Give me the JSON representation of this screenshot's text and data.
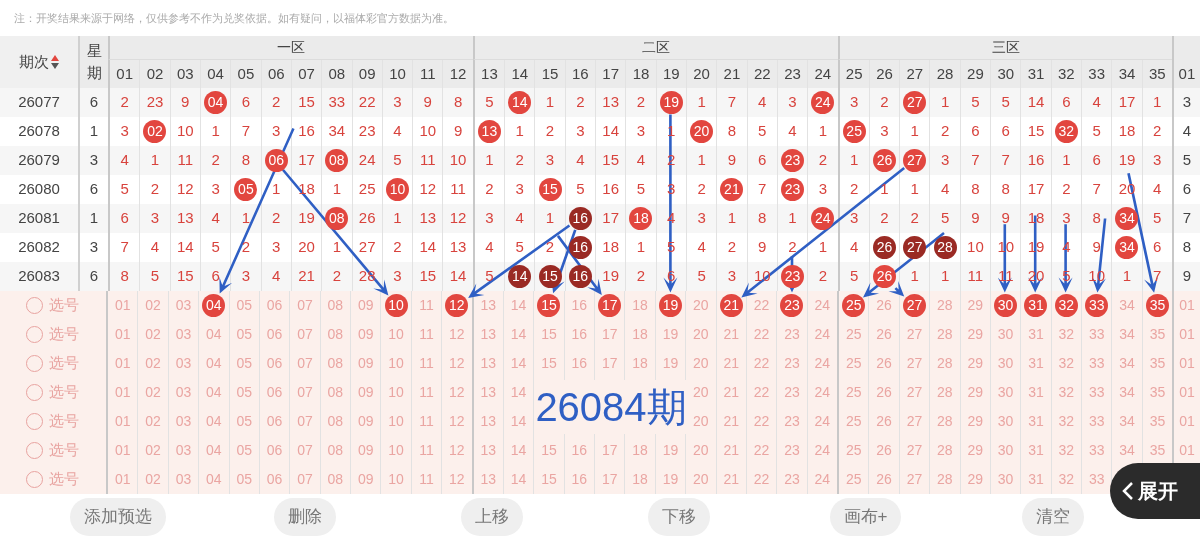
{
  "note": "注：开奖结果来源于网络，仅供参考不作为兑奖依据。如有疑问，以福体彩官方数据为准。",
  "header": {
    "issue": "期次",
    "weekday": "星期",
    "zones": [
      "一区",
      "二区",
      "三区"
    ],
    "columns": [
      "01",
      "02",
      "03",
      "04",
      "05",
      "06",
      "07",
      "08",
      "09",
      "10",
      "11",
      "12",
      "13",
      "14",
      "15",
      "16",
      "17",
      "18",
      "19",
      "20",
      "21",
      "22",
      "23",
      "24",
      "25",
      "26",
      "27",
      "28",
      "29",
      "30",
      "31",
      "32",
      "33",
      "34",
      "35",
      "01"
    ]
  },
  "rows": [
    {
      "issue": "26077",
      "weekday": "6",
      "cells": [
        "2",
        "23",
        "9",
        {
          "text": "04",
          "color": "#e2463f"
        },
        "6",
        "2",
        "15",
        "33",
        "22",
        "3",
        "9",
        "8",
        "5",
        {
          "text": "14",
          "color": "#e2463f"
        },
        "1",
        "2",
        "13",
        "2",
        {
          "text": "19",
          "color": "#e2463f"
        },
        "1",
        "7",
        "4",
        "3",
        {
          "text": "24",
          "color": "#e2463f"
        },
        "3",
        "2",
        {
          "text": "27",
          "color": "#e2463f"
        },
        "1",
        "5",
        "5",
        "14",
        "6",
        "4",
        "17",
        "1",
        "3"
      ]
    },
    {
      "issue": "26078",
      "weekday": "1",
      "cells": [
        "3",
        {
          "text": "02",
          "color": "#e2463f"
        },
        "10",
        "1",
        "7",
        "3",
        "16",
        "34",
        "23",
        "4",
        "10",
        "9",
        {
          "text": "13",
          "color": "#e2463f"
        },
        "1",
        "2",
        "3",
        "14",
        "3",
        "1",
        {
          "text": "20",
          "color": "#e2463f"
        },
        "8",
        "5",
        "4",
        "1",
        {
          "text": "25",
          "color": "#e2463f"
        },
        "3",
        "1",
        "2",
        "6",
        "6",
        "15",
        {
          "text": "32",
          "color": "#e2463f"
        },
        "5",
        "18",
        "2",
        "4"
      ]
    },
    {
      "issue": "26079",
      "weekday": "3",
      "cells": [
        "4",
        "1",
        "11",
        "2",
        "8",
        {
          "text": "06",
          "color": "#e2463f"
        },
        "17",
        {
          "text": "08",
          "color": "#e2463f"
        },
        "24",
        "5",
        "11",
        "10",
        "1",
        "2",
        "3",
        "4",
        "15",
        "4",
        "2",
        "1",
        "9",
        "6",
        {
          "text": "23",
          "color": "#e2463f"
        },
        "2",
        "1",
        {
          "text": "26",
          "color": "#e2463f"
        },
        {
          "text": "27",
          "color": "#e2463f"
        },
        "3",
        "7",
        "7",
        "16",
        "1",
        "6",
        "19",
        "3",
        "5"
      ]
    },
    {
      "issue": "26080",
      "weekday": "6",
      "cells": [
        "5",
        "2",
        "12",
        "3",
        {
          "text": "05",
          "color": "#e2463f"
        },
        "1",
        "18",
        "1",
        "25",
        {
          "text": "10",
          "color": "#e2463f"
        },
        "12",
        "11",
        "2",
        "3",
        {
          "text": "15",
          "color": "#e2463f"
        },
        "5",
        "16",
        "5",
        "3",
        "2",
        {
          "text": "21",
          "color": "#e2463f"
        },
        "7",
        {
          "text": "23",
          "color": "#e2463f"
        },
        "3",
        "2",
        "1",
        "1",
        "4",
        "8",
        "8",
        "17",
        "2",
        "7",
        "20",
        "4",
        "6"
      ]
    },
    {
      "issue": "26081",
      "weekday": "1",
      "cells": [
        "6",
        "3",
        "13",
        "4",
        "1",
        "2",
        "19",
        {
          "text": "08",
          "color": "#e2463f"
        },
        "26",
        "1",
        "13",
        "12",
        "3",
        "4",
        "1",
        {
          "text": "16",
          "color": "#9a2a24"
        },
        "17",
        {
          "text": "18",
          "color": "#e2463f"
        },
        "4",
        "3",
        "1",
        "8",
        "1",
        {
          "text": "24",
          "color": "#e2463f"
        },
        "3",
        "2",
        "2",
        "5",
        "9",
        "9",
        "18",
        "3",
        "8",
        {
          "text": "34",
          "color": "#e2463f"
        },
        "5",
        "7"
      ]
    },
    {
      "issue": "26082",
      "weekday": "3",
      "cells": [
        "7",
        "4",
        "14",
        "5",
        "2",
        "3",
        "20",
        "1",
        "27",
        "2",
        "14",
        "13",
        "4",
        "5",
        "2",
        {
          "text": "16",
          "color": "#9a2a24"
        },
        "18",
        "1",
        "5",
        "4",
        "2",
        "9",
        "2",
        "1",
        "4",
        {
          "text": "26",
          "color": "#9a2a24"
        },
        {
          "text": "27",
          "color": "#9a2a24"
        },
        {
          "text": "28",
          "color": "#9a2a24"
        },
        "10",
        "10",
        "19",
        "4",
        "9",
        {
          "text": "34",
          "color": "#e2463f"
        },
        "6",
        "8"
      ]
    },
    {
      "issue": "26083",
      "weekday": "6",
      "cells": [
        "8",
        "5",
        "15",
        "6",
        "3",
        "4",
        "21",
        "2",
        "28",
        "3",
        "15",
        "14",
        "5",
        {
          "text": "14",
          "color": "#9a2a24"
        },
        {
          "text": "15",
          "color": "#9a2a24"
        },
        {
          "text": "16",
          "color": "#9a2a24"
        },
        "19",
        "2",
        "6",
        "5",
        "3",
        "10",
        {
          "text": "23",
          "color": "#e2463f"
        },
        "2",
        "5",
        {
          "text": "26",
          "color": "#e2463f"
        },
        "1",
        "1",
        "11",
        "11",
        "20",
        "5",
        "10",
        "1",
        "7",
        "9"
      ]
    }
  ],
  "pick_rows": [
    {
      "label": "选号",
      "checked": false,
      "numbers": [
        {
          "text": "01",
          "selected": false
        },
        {
          "text": "02",
          "selected": false
        },
        {
          "text": "03",
          "selected": false
        },
        {
          "text": "04",
          "selected": true
        },
        {
          "text": "05",
          "selected": false
        },
        {
          "text": "06",
          "selected": false
        },
        {
          "text": "07",
          "selected": false
        },
        {
          "text": "08",
          "selected": false
        },
        {
          "text": "09",
          "selected": false
        },
        {
          "text": "10",
          "selected": true
        },
        {
          "text": "11",
          "selected": false
        },
        {
          "text": "12",
          "selected": true
        },
        {
          "text": "13",
          "selected": false
        },
        {
          "text": "14",
          "selected": false
        },
        {
          "text": "15",
          "selected": true
        },
        {
          "text": "16",
          "selected": false
        },
        {
          "text": "17",
          "selected": true
        },
        {
          "text": "18",
          "selected": false
        },
        {
          "text": "19",
          "selected": true
        },
        {
          "text": "20",
          "selected": false
        },
        {
          "text": "21",
          "selected": true
        },
        {
          "text": "22",
          "selected": false
        },
        {
          "text": "23",
          "selected": true
        },
        {
          "text": "24",
          "selected": false
        },
        {
          "text": "25",
          "selected": true
        },
        {
          "text": "26",
          "selected": false
        },
        {
          "text": "27",
          "selected": true
        },
        {
          "text": "28",
          "selected": false
        },
        {
          "text": "29",
          "selected": false
        },
        {
          "text": "30",
          "selected": true
        },
        {
          "text": "31",
          "selected": true
        },
        {
          "text": "32",
          "selected": true
        },
        {
          "text": "33",
          "selected": true
        },
        {
          "text": "34",
          "selected": false
        },
        {
          "text": "35",
          "selected": true
        },
        {
          "text": "01",
          "selected": false
        }
      ]
    },
    {
      "label": "选号",
      "checked": false,
      "numbers": [
        {
          "text": "01",
          "selected": false
        },
        {
          "text": "02",
          "selected": false
        },
        {
          "text": "03",
          "selected": false
        },
        {
          "text": "04",
          "selected": false
        },
        {
          "text": "05",
          "selected": false
        },
        {
          "text": "06",
          "selected": false
        },
        {
          "text": "07",
          "selected": false
        },
        {
          "text": "08",
          "selected": false
        },
        {
          "text": "09",
          "selected": false
        },
        {
          "text": "10",
          "selected": false
        },
        {
          "text": "11",
          "selected": false
        },
        {
          "text": "12",
          "selected": false
        },
        {
          "text": "13",
          "selected": false
        },
        {
          "text": "14",
          "selected": false
        },
        {
          "text": "15",
          "selected": false
        },
        {
          "text": "16",
          "selected": false
        },
        {
          "text": "17",
          "selected": false
        },
        {
          "text": "18",
          "selected": false
        },
        {
          "text": "19",
          "selected": false
        },
        {
          "text": "20",
          "selected": false
        },
        {
          "text": "21",
          "selected": false
        },
        {
          "text": "22",
          "selected": false
        },
        {
          "text": "23",
          "selected": false
        },
        {
          "text": "24",
          "selected": false
        },
        {
          "text": "25",
          "selected": false
        },
        {
          "text": "26",
          "selected": false
        },
        {
          "text": "27",
          "selected": false
        },
        {
          "text": "28",
          "selected": false
        },
        {
          "text": "29",
          "selected": false
        },
        {
          "text": "30",
          "selected": false
        },
        {
          "text": "31",
          "selected": false
        },
        {
          "text": "32",
          "selected": false
        },
        {
          "text": "33",
          "selected": false
        },
        {
          "text": "34",
          "selected": false
        },
        {
          "text": "35",
          "selected": false
        },
        {
          "text": "01",
          "selected": false
        }
      ]
    },
    {
      "label": "选号",
      "checked": false,
      "numbers": [
        {
          "text": "01",
          "selected": false
        },
        {
          "text": "02",
          "selected": false
        },
        {
          "text": "03",
          "selected": false
        },
        {
          "text": "04",
          "selected": false
        },
        {
          "text": "05",
          "selected": false
        },
        {
          "text": "06",
          "selected": false
        },
        {
          "text": "07",
          "selected": false
        },
        {
          "text": "08",
          "selected": false
        },
        {
          "text": "09",
          "selected": false
        },
        {
          "text": "10",
          "selected": false
        },
        {
          "text": "11",
          "selected": false
        },
        {
          "text": "12",
          "selected": false
        },
        {
          "text": "13",
          "selected": false
        },
        {
          "text": "14",
          "selected": false
        },
        {
          "text": "15",
          "selected": false
        },
        {
          "text": "16",
          "selected": false
        },
        {
          "text": "17",
          "selected": false
        },
        {
          "text": "18",
          "selected": false
        },
        {
          "text": "19",
          "selected": false
        },
        {
          "text": "20",
          "selected": false
        },
        {
          "text": "21",
          "selected": false
        },
        {
          "text": "22",
          "selected": false
        },
        {
          "text": "23",
          "selected": false
        },
        {
          "text": "24",
          "selected": false
        },
        {
          "text": "25",
          "selected": false
        },
        {
          "text": "26",
          "selected": false
        },
        {
          "text": "27",
          "selected": false
        },
        {
          "text": "28",
          "selected": false
        },
        {
          "text": "29",
          "selected": false
        },
        {
          "text": "30",
          "selected": false
        },
        {
          "text": "31",
          "selected": false
        },
        {
          "text": "32",
          "selected": false
        },
        {
          "text": "33",
          "selected": false
        },
        {
          "text": "34",
          "selected": false
        },
        {
          "text": "35",
          "selected": false
        },
        {
          "text": "01",
          "selected": false
        }
      ]
    },
    {
      "label": "选号",
      "checked": false,
      "numbers": [
        {
          "text": "01",
          "selected": false
        },
        {
          "text": "02",
          "selected": false
        },
        {
          "text": "03",
          "selected": false
        },
        {
          "text": "04",
          "selected": false
        },
        {
          "text": "05",
          "selected": false
        },
        {
          "text": "06",
          "selected": false
        },
        {
          "text": "07",
          "selected": false
        },
        {
          "text": "08",
          "selected": false
        },
        {
          "text": "09",
          "selected": false
        },
        {
          "text": "10",
          "selected": false
        },
        {
          "text": "11",
          "selected": false
        },
        {
          "text": "12",
          "selected": false
        },
        {
          "text": "13",
          "selected": false
        },
        {
          "text": "14",
          "selected": false
        }
      ],
      "numbers_after_annotation": [
        {
          "text": "20",
          "selected": false
        },
        {
          "text": "21",
          "selected": false
        },
        {
          "text": "22",
          "selected": false
        },
        {
          "text": "23",
          "selected": false
        },
        {
          "text": "24",
          "selected": false
        },
        {
          "text": "25",
          "selected": false
        },
        {
          "text": "26",
          "selected": false
        },
        {
          "text": "27",
          "selected": false
        },
        {
          "text": "28",
          "selected": false
        },
        {
          "text": "29",
          "selected": false
        },
        {
          "text": "30",
          "selected": false
        },
        {
          "text": "31",
          "selected": false
        },
        {
          "text": "32",
          "selected": false
        },
        {
          "text": "33",
          "selected": false
        },
        {
          "text": "34",
          "selected": false
        },
        {
          "text": "35",
          "selected": false
        },
        {
          "text": "01",
          "selected": false
        }
      ]
    },
    {
      "label": "选号",
      "checked": false,
      "numbers": [
        {
          "text": "01",
          "selected": false
        },
        {
          "text": "02",
          "selected": false
        },
        {
          "text": "03",
          "selected": false
        },
        {
          "text": "04",
          "selected": false
        },
        {
          "text": "05",
          "selected": false
        },
        {
          "text": "06",
          "selected": false
        },
        {
          "text": "07",
          "selected": false
        },
        {
          "text": "08",
          "selected": false
        },
        {
          "text": "09",
          "selected": false
        },
        {
          "text": "10",
          "selected": false
        },
        {
          "text": "11",
          "selected": false
        },
        {
          "text": "12",
          "selected": false
        },
        {
          "text": "13",
          "selected": false
        },
        {
          "text": "14",
          "selected": false
        }
      ],
      "numbers_after_annotation": [
        {
          "text": "20",
          "selected": false
        },
        {
          "text": "21",
          "selected": false
        },
        {
          "text": "22",
          "selected": false
        },
        {
          "text": "23",
          "selected": false
        },
        {
          "text": "24",
          "selected": false
        },
        {
          "text": "25",
          "selected": false
        },
        {
          "text": "26",
          "selected": false
        },
        {
          "text": "27",
          "selected": false
        },
        {
          "text": "28",
          "selected": false
        },
        {
          "text": "29",
          "selected": false
        },
        {
          "text": "30",
          "selected": false
        },
        {
          "text": "31",
          "selected": false
        },
        {
          "text": "32",
          "selected": false
        },
        {
          "text": "33",
          "selected": false
        },
        {
          "text": "34",
          "selected": false
        },
        {
          "text": "35",
          "selected": false
        },
        {
          "text": "01",
          "selected": false
        }
      ]
    },
    {
      "label": "选号",
      "checked": false,
      "numbers": [
        {
          "text": "01",
          "selected": false
        },
        {
          "text": "02",
          "selected": false
        },
        {
          "text": "03",
          "selected": false
        },
        {
          "text": "04",
          "selected": false
        },
        {
          "text": "05",
          "selected": false
        },
        {
          "text": "06",
          "selected": false
        },
        {
          "text": "07",
          "selected": false
        },
        {
          "text": "08",
          "selected": false
        },
        {
          "text": "09",
          "selected": false
        },
        {
          "text": "10",
          "selected": false
        },
        {
          "text": "11",
          "selected": false
        },
        {
          "text": "12",
          "selected": false
        },
        {
          "text": "13",
          "selected": false
        },
        {
          "text": "14",
          "selected": false
        },
        {
          "text": "15",
          "selected": false
        },
        {
          "text": "16",
          "selected": false
        },
        {
          "text": "17",
          "selected": false
        },
        {
          "text": "18",
          "selected": false
        },
        {
          "text": "19",
          "selected": false
        },
        {
          "text": "20",
          "selected": false
        },
        {
          "text": "21",
          "selected": false
        },
        {
          "text": "22",
          "selected": false
        },
        {
          "text": "23",
          "selected": false
        },
        {
          "text": "24",
          "selected": false
        },
        {
          "text": "25",
          "selected": false
        },
        {
          "text": "26",
          "selected": false
        },
        {
          "text": "27",
          "selected": false
        },
        {
          "text": "28",
          "selected": false
        },
        {
          "text": "29",
          "selected": false
        },
        {
          "text": "30",
          "selected": false
        },
        {
          "text": "31",
          "selected": false
        },
        {
          "text": "32",
          "selected": false
        },
        {
          "text": "33",
          "selected": false
        },
        {
          "text": "34",
          "selected": false
        },
        {
          "text": "35",
          "selected": false
        },
        {
          "text": "01",
          "selected": false
        }
      ]
    },
    {
      "label": "选号",
      "checked": false,
      "numbers": [
        {
          "text": "01",
          "selected": false
        },
        {
          "text": "02",
          "selected": false
        },
        {
          "text": "03",
          "selected": false
        },
        {
          "text": "04",
          "selected": false
        },
        {
          "text": "05",
          "selected": false
        },
        {
          "text": "06",
          "selected": false
        },
        {
          "text": "07",
          "selected": false
        },
        {
          "text": "08",
          "selected": false
        },
        {
          "text": "09",
          "selected": false
        },
        {
          "text": "10",
          "selected": false
        },
        {
          "text": "11",
          "selected": false
        },
        {
          "text": "12",
          "selected": false
        },
        {
          "text": "13",
          "selected": false
        },
        {
          "text": "14",
          "selected": false
        },
        {
          "text": "15",
          "selected": false
        },
        {
          "text": "16",
          "selected": false
        },
        {
          "text": "17",
          "selected": false
        },
        {
          "text": "18",
          "selected": false
        },
        {
          "text": "19",
          "selected": false
        },
        {
          "text": "20",
          "selected": false
        },
        {
          "text": "21",
          "selected": false
        },
        {
          "text": "22",
          "selected": false
        },
        {
          "text": "23",
          "selected": false
        },
        {
          "text": "24",
          "selected": false
        },
        {
          "text": "25",
          "selected": false
        },
        {
          "text": "26",
          "selected": false
        },
        {
          "text": "27",
          "selected": false
        },
        {
          "text": "28",
          "selected": false
        },
        {
          "text": "29",
          "selected": false
        },
        {
          "text": "30",
          "selected": false
        },
        {
          "text": "31",
          "selected": false
        },
        {
          "text": "32",
          "selected": false
        },
        {
          "text": "33",
          "selected": false
        }
      ]
    }
  ],
  "overlay_text": "26084期",
  "expand_button": "展开",
  "buttons": [
    "添加预选",
    "删除",
    "上移",
    "下移",
    "画布+",
    "清空"
  ]
}
